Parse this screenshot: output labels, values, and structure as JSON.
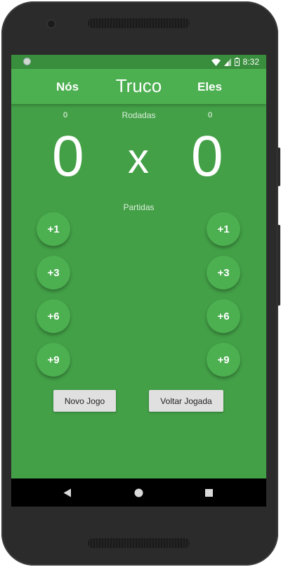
{
  "status_bar": {
    "time": "8:32"
  },
  "app_bar": {
    "left_team": "Nós",
    "title": "Truco",
    "right_team": "Eles"
  },
  "rounds": {
    "label": "Rodadas",
    "nos": "0",
    "eles": "0"
  },
  "score": {
    "nos": "0",
    "separator": "x",
    "eles": "0"
  },
  "matches": {
    "label": "Partidas"
  },
  "buttons_left": [
    "+1",
    "+3",
    "+6",
    "+9"
  ],
  "buttons_right": [
    "+1",
    "+3",
    "+6",
    "+9"
  ],
  "actions": {
    "new_game": "Novo Jogo",
    "undo": "Voltar Jogada"
  },
  "colors": {
    "background": "#43a047",
    "app_bar": "#4caf50",
    "status_bar": "#388e3c"
  }
}
